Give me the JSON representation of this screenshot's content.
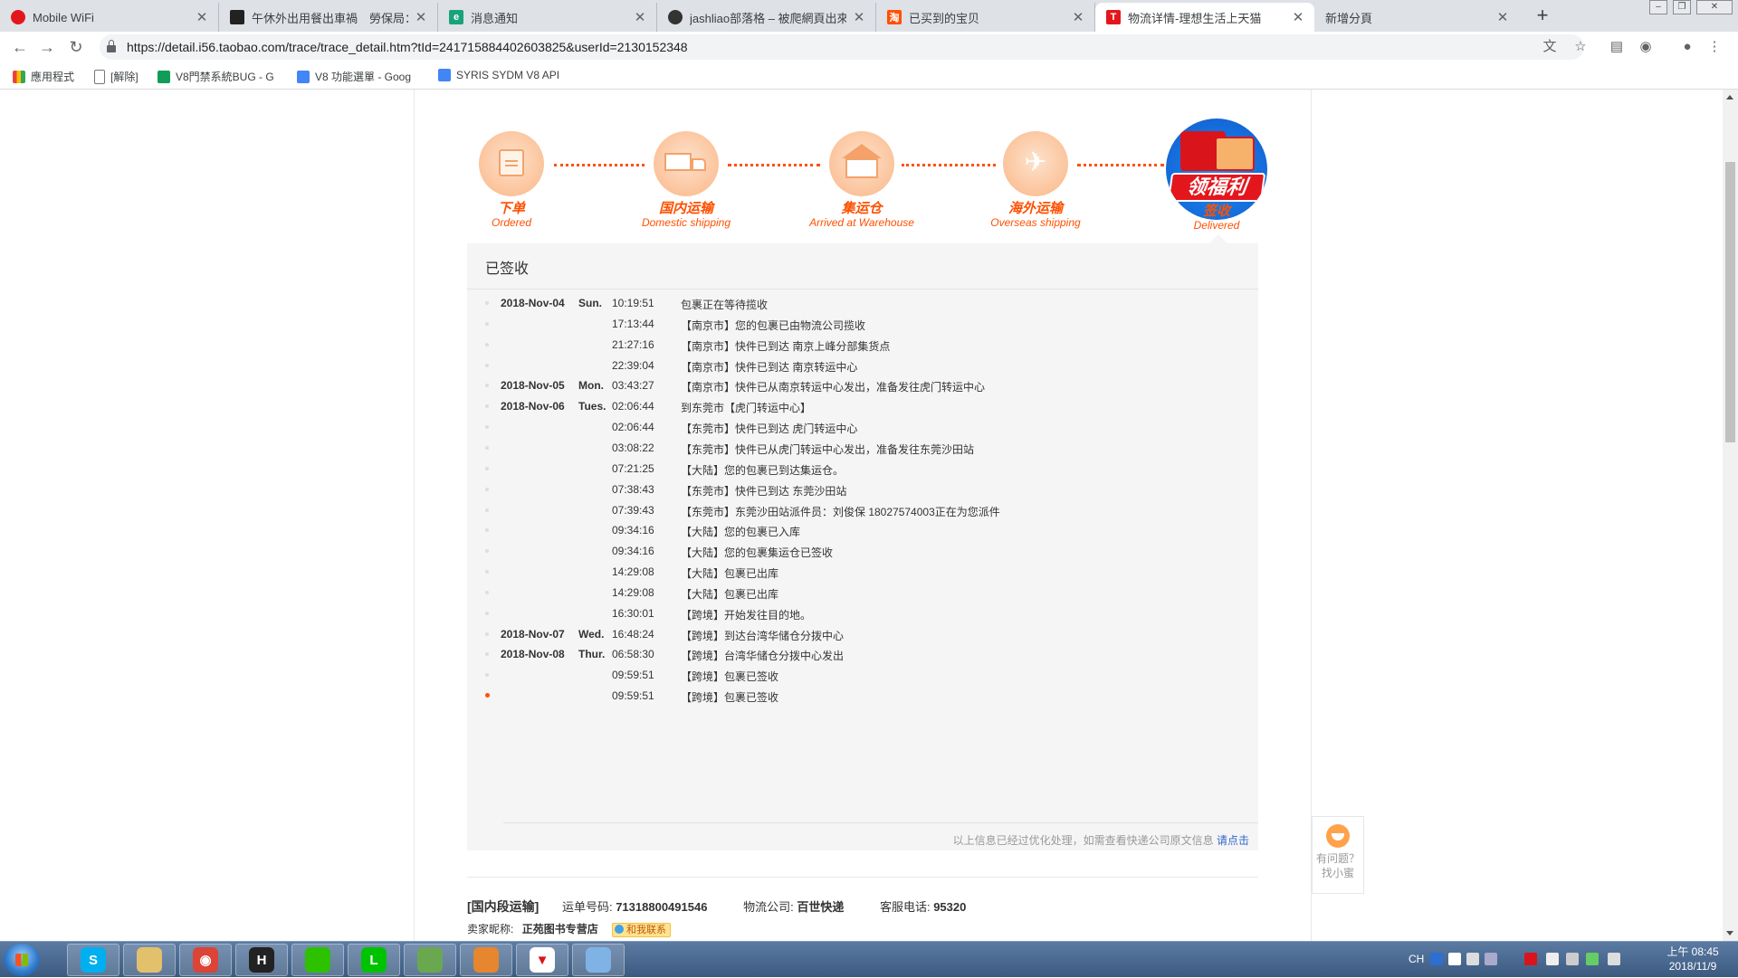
{
  "browser": {
    "tabs": [
      {
        "title": "Mobile WiFi",
        "favicon": "huawei-icon"
      },
      {
        "title": "午休外出用餐出車禍　勞保局：非",
        "favicon": "news-icon"
      },
      {
        "title": "消息通知",
        "favicon": "e-icon"
      },
      {
        "title": "jashliao部落格 – 被爬網頁出來",
        "favicon": "people-icon"
      },
      {
        "title": "已买到的宝贝",
        "favicon": "taobao-icon"
      },
      {
        "title": "物流详情-理想生活上天猫",
        "favicon": "tmall-icon",
        "active": true
      },
      {
        "title": "新增分頁",
        "favicon": ""
      }
    ],
    "url": "https://detail.i56.taobao.com/trace/trace_detail.htm?tId=241715884402603825&userId=2130152348",
    "bookmarks": [
      {
        "label": "應用程式",
        "icon": "apps-icon"
      },
      {
        "label": "[解除]",
        "icon": "page-icon"
      },
      {
        "label": "V8門禁系統BUG - G",
        "icon": "sheets-icon"
      },
      {
        "label": "V8 功能選單 - Goog",
        "icon": "docs-icon"
      },
      {
        "label": "SYRIS SYDM V8 API",
        "icon": "docs-icon"
      }
    ]
  },
  "steps": [
    {
      "zh": "下单",
      "en": "Ordered"
    },
    {
      "zh": "国内运输",
      "en": "Domestic shipping"
    },
    {
      "zh": "集运仓",
      "en": "Arrived at Warehouse"
    },
    {
      "zh": "海外运输",
      "en": "Overseas shipping"
    },
    {
      "zh": "签收",
      "en": "Delivered"
    }
  ],
  "promo": {
    "text": "领福利"
  },
  "status_title": "已签收",
  "events": [
    {
      "date": "2018-Nov-04",
      "day": "Sun.",
      "time": "10:19:51",
      "desc": "包裹正在等待揽收"
    },
    {
      "date": "",
      "day": "",
      "time": "17:13:44",
      "desc": "【南京市】您的包裹已由物流公司揽收"
    },
    {
      "date": "",
      "day": "",
      "time": "21:27:16",
      "desc": "【南京市】快件已到达 南京上峰分部集货点"
    },
    {
      "date": "",
      "day": "",
      "time": "22:39:04",
      "desc": "【南京市】快件已到达 南京转运中心"
    },
    {
      "date": "2018-Nov-05",
      "day": "Mon.",
      "time": "03:43:27",
      "desc": "【南京市】快件已从南京转运中心发出，准备发往虎门转运中心"
    },
    {
      "date": "2018-Nov-06",
      "day": "Tues.",
      "time": "02:06:44",
      "desc": "到东莞市【虎门转运中心】"
    },
    {
      "date": "",
      "day": "",
      "time": "02:06:44",
      "desc": "【东莞市】快件已到达 虎门转运中心"
    },
    {
      "date": "",
      "day": "",
      "time": "03:08:22",
      "desc": "【东莞市】快件已从虎门转运中心发出，准备发往东莞沙田站"
    },
    {
      "date": "",
      "day": "",
      "time": "07:21:25",
      "desc": "【大陆】您的包裹已到达集运仓。"
    },
    {
      "date": "",
      "day": "",
      "time": "07:38:43",
      "desc": "【东莞市】快件已到达 东莞沙田站"
    },
    {
      "date": "",
      "day": "",
      "time": "07:39:43",
      "desc": "【东莞市】东莞沙田站派件员：刘俊保 18027574003正在为您派件"
    },
    {
      "date": "",
      "day": "",
      "time": "09:34:16",
      "desc": "【大陆】您的包裹已入库"
    },
    {
      "date": "",
      "day": "",
      "time": "09:34:16",
      "desc": "【大陆】您的包裹集运仓已签收"
    },
    {
      "date": "",
      "day": "",
      "time": "14:29:08",
      "desc": "【大陆】包裹已出库"
    },
    {
      "date": "",
      "day": "",
      "time": "14:29:08",
      "desc": "【大陆】包裹已出库"
    },
    {
      "date": "",
      "day": "",
      "time": "16:30:01",
      "desc": "【跨境】开始发往目的地。"
    },
    {
      "date": "2018-Nov-07",
      "day": "Wed.",
      "time": "16:48:24",
      "desc": "【跨境】到达台湾华储仓分拨中心"
    },
    {
      "date": "2018-Nov-08",
      "day": "Thur.",
      "time": "06:58:30",
      "desc": "【跨境】台湾华储仓分拨中心发出"
    },
    {
      "date": "",
      "day": "",
      "time": "09:59:51",
      "desc": "【跨境】包裹已签收"
    },
    {
      "date": "",
      "day": "",
      "time": "09:59:51",
      "desc": "【跨境】包裹已签收"
    }
  ],
  "note": {
    "text": "以上信息已经过优化处理，如需查看快递公司原文信息",
    "link": "请点击"
  },
  "shipment": {
    "section": "[国内段运输]",
    "tracking_label": "运单号码:",
    "tracking_no": "71318800491546",
    "company_label": "物流公司:",
    "company": "百世快递",
    "phone_label": "客服电话:",
    "phone": "95320"
  },
  "seller": {
    "label": "卖家昵称:",
    "name": "正苑图书专营店",
    "contact": "和我联系"
  },
  "help": {
    "line1": "有问题？",
    "line2": "找小蜜"
  },
  "taskbar": {
    "apps": [
      "skype-icon",
      "explorer-icon",
      "chrome-icon",
      "h-icon",
      "wechat-icon",
      "line-icon",
      "notepad-icon",
      "office-icon",
      "security-icon",
      "paint-icon"
    ],
    "lang": "CH",
    "time": "上午 08:45",
    "date": "2018/11/9"
  },
  "colors": {
    "accent": "#ff5000",
    "box_bg": "#f5f5f5",
    "link": "#3366cc"
  }
}
